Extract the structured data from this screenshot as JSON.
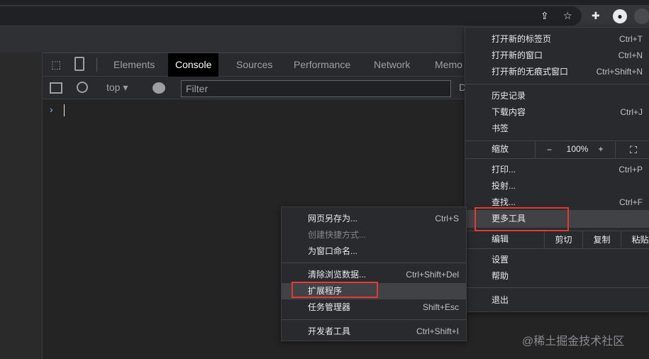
{
  "browser": {
    "icons": [
      "share-icon",
      "star-icon",
      "extensions-icon",
      "profile-icon",
      "menu-icon"
    ]
  },
  "devtools": {
    "tabs": [
      "Elements",
      "Console",
      "Sources",
      "Performance",
      "Network",
      "Memo"
    ],
    "active_tab": "Console",
    "context": "top",
    "filter_placeholder": "Filter",
    "truncated_label": "D",
    "prompt": "›"
  },
  "chrome_menu": {
    "items": [
      {
        "label": "打开新的标签页",
        "shortcut": "Ctrl+T"
      },
      {
        "label": "打开新的窗口",
        "shortcut": "Ctrl+N"
      },
      {
        "label": "打开新的无痕式窗口",
        "shortcut": "Ctrl+Shift+N"
      },
      {
        "label": "历史记录",
        "shortcut": ""
      },
      {
        "label": "下载内容",
        "shortcut": "Ctrl+J"
      },
      {
        "label": "书签",
        "shortcut": ""
      },
      {
        "label": "打印...",
        "shortcut": "Ctrl+P"
      },
      {
        "label": "投射...",
        "shortcut": ""
      },
      {
        "label": "查找...",
        "shortcut": "Ctrl+F"
      },
      {
        "label": "更多工具",
        "shortcut": ""
      },
      {
        "label": "设置",
        "shortcut": ""
      },
      {
        "label": "帮助",
        "shortcut": ""
      },
      {
        "label": "退出",
        "shortcut": ""
      }
    ],
    "zoom": {
      "label": "缩放",
      "minus": "−",
      "value": "100%",
      "plus": "+"
    },
    "edit": {
      "label": "编辑",
      "cut": "剪切",
      "copy": "复制",
      "paste": "粘贴"
    }
  },
  "more_tools_menu": {
    "items": [
      {
        "label": "网页另存为...",
        "shortcut": "Ctrl+S",
        "disabled": false
      },
      {
        "label": "创建快捷方式...",
        "shortcut": "",
        "disabled": true
      },
      {
        "label": "为窗口命名...",
        "shortcut": "",
        "disabled": false
      },
      {
        "label": "清除浏览数据...",
        "shortcut": "Ctrl+Shift+Del",
        "disabled": false
      },
      {
        "label": "扩展程序",
        "shortcut": "",
        "disabled": false
      },
      {
        "label": "任务管理器",
        "shortcut": "Shift+Esc",
        "disabled": false
      },
      {
        "label": "开发者工具",
        "shortcut": "Ctrl+Shift+I",
        "disabled": false
      }
    ]
  },
  "watermark": "@稀土掘金技术社区",
  "colors": {
    "highlight_box": "#e53935",
    "accent": "#8ab4f8"
  }
}
